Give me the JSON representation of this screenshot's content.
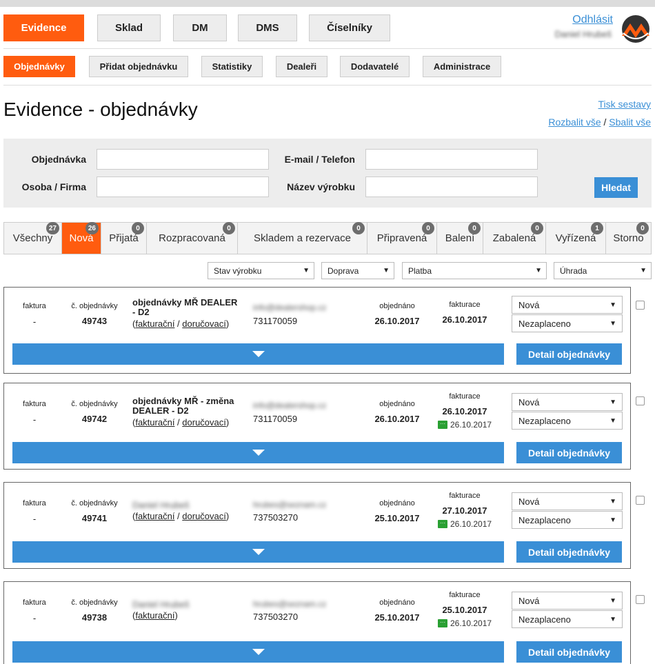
{
  "user": {
    "logout": "Odhlásit",
    "name": "Daniel Hrubeš"
  },
  "mainnav": [
    "Evidence",
    "Sklad",
    "DM",
    "DMS",
    "Číselníky"
  ],
  "subnav": [
    "Objednávky",
    "Přidat objednávku",
    "Statistiky",
    "Dealeři",
    "Dodavatelé",
    "Administrace"
  ],
  "page": {
    "title": "Evidence - objednávky",
    "print": "Tisk sestavy",
    "expand": "Rozbalit vše",
    "slash": "/",
    "collapse": "Sbalit vše"
  },
  "search": {
    "order_label": "Objednávka",
    "email_label": "E-mail / Telefon",
    "person_label": "Osoba / Firma",
    "product_label": "Název výrobku",
    "button": "Hledat"
  },
  "tabs": [
    {
      "label": "Všechny",
      "count": "27"
    },
    {
      "label": "Nová",
      "count": "26"
    },
    {
      "label": "Přijatá",
      "count": "0"
    },
    {
      "label": "Rozpracovaná",
      "count": "0"
    },
    {
      "label": "Skladem a rezervace",
      "count": "0"
    },
    {
      "label": "Připravená",
      "count": "0"
    },
    {
      "label": "Balení",
      "count": "0"
    },
    {
      "label": "Zabalená",
      "count": "0"
    },
    {
      "label": "Vyřízená",
      "count": "1"
    },
    {
      "label": "Storno",
      "count": "0"
    }
  ],
  "filters": [
    "Stav výrobku",
    "Doprava",
    "Platba",
    "Úhrada"
  ],
  "labels": {
    "faktura": "faktura",
    "order_no": "č. objednávky",
    "ordered": "objednáno",
    "invoicing": "fakturace",
    "billing": "fakturační",
    "delivery": "doručovací",
    "detail": "Detail objednávky",
    "open": "(",
    "close": ")"
  },
  "orders": [
    {
      "faktura": "-",
      "number": "49743",
      "name": "objednávky MŘ DEALER - D2",
      "email": "info@dealershop.cz",
      "phone": "731170059",
      "ordered": "26.10.2017",
      "invoice": "26.10.2017",
      "note": "",
      "status": "Nová",
      "payment": "Nezaplaceno"
    },
    {
      "faktura": "-",
      "number": "49742",
      "name": "objednávky MŘ - změna DEALER - D2",
      "email": "info@dealershop.cz",
      "phone": "731170059",
      "ordered": "26.10.2017",
      "invoice": "26.10.2017",
      "note": "26.10.2017",
      "status": "Nová",
      "payment": "Nezaplaceno"
    },
    {
      "faktura": "-",
      "number": "49741",
      "name": "Daniel Hrubeš",
      "email": "hrubes@seznam.cz",
      "phone": "737503270",
      "ordered": "25.10.2017",
      "invoice": "27.10.2017",
      "note": "26.10.2017",
      "status": "Nová",
      "payment": "Nezaplaceno"
    },
    {
      "faktura": "-",
      "number": "49738",
      "name": "Daniel Hrubeš",
      "email": "hrubes@seznam.cz",
      "phone": "737503270",
      "ordered": "25.10.2017",
      "invoice": "25.10.2017",
      "note": "26.10.2017",
      "status": "Nová",
      "payment": "Nezaplaceno"
    }
  ],
  "colors": {
    "accent": "#ff5c0f",
    "blue": "#3a8fd6",
    "badge": "#6d6d6d",
    "note": "#2aa033"
  }
}
